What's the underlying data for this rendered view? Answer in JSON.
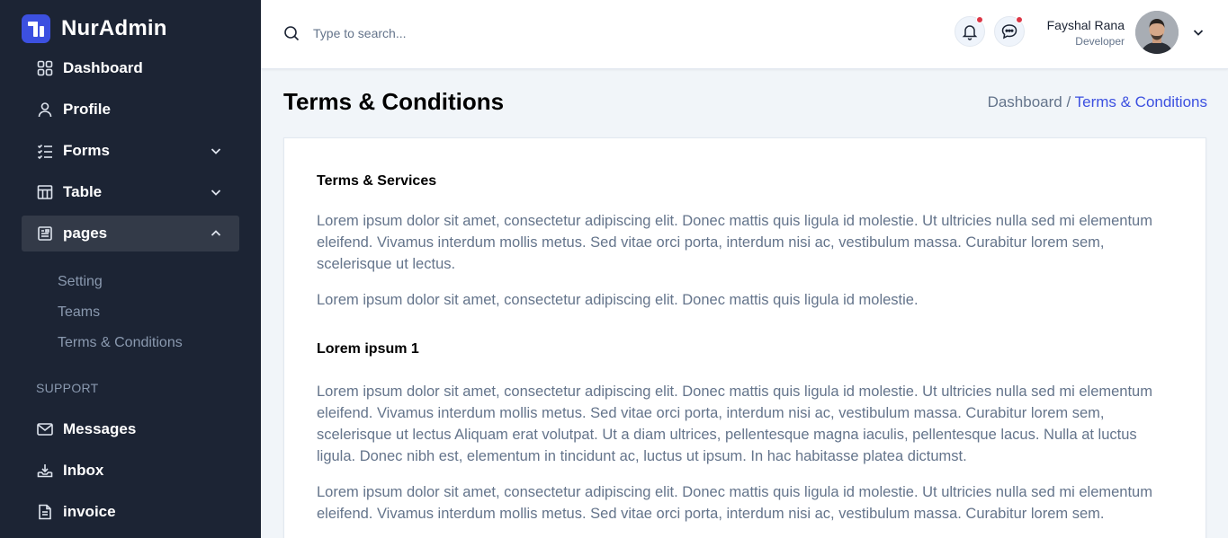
{
  "app": {
    "name": "NurAdmin"
  },
  "sidebar": {
    "items": [
      {
        "label": "Dashboard"
      },
      {
        "label": "Profile"
      },
      {
        "label": "Forms"
      },
      {
        "label": "Table"
      },
      {
        "label": "pages"
      }
    ],
    "pages_subitems": [
      {
        "label": "Setting"
      },
      {
        "label": "Teams"
      },
      {
        "label": "Terms & Conditions"
      }
    ],
    "support_label": "SUPPORT",
    "support_items": [
      {
        "label": "Messages"
      },
      {
        "label": "Inbox"
      },
      {
        "label": "invoice"
      }
    ]
  },
  "header": {
    "search_placeholder": "Type to search...",
    "user": {
      "name": "Fayshal Rana",
      "role": "Developer"
    }
  },
  "page": {
    "title": "Terms & Conditions",
    "breadcrumb": {
      "home": "Dashboard /",
      "current": "Terms & Conditions"
    }
  },
  "content": {
    "sections": [
      {
        "title": "Terms & Services",
        "paragraphs": [
          "Lorem ipsum dolor sit amet, consectetur adipiscing elit. Donec mattis quis ligula id molestie. Ut ultricies nulla sed mi elementum eleifend. Vivamus interdum mollis metus. Sed vitae orci porta, interdum nisi ac, vestibulum massa. Curabitur lorem sem, scelerisque ut lectus.",
          "Lorem ipsum dolor sit amet, consectetur adipiscing elit. Donec mattis quis ligula id molestie."
        ]
      },
      {
        "title": "Lorem ipsum 1",
        "paragraphs": [
          "Lorem ipsum dolor sit amet, consectetur adipiscing elit. Donec mattis quis ligula id molestie. Ut ultricies nulla sed mi elementum eleifend. Vivamus interdum mollis metus. Sed vitae orci porta, interdum nisi ac, vestibulum massa. Curabitur lorem sem, scelerisque ut lectus Aliquam erat volutpat. Ut a diam ultrices, pellentesque magna iaculis, pellentesque lacus. Nulla at luctus ligula. Donec nibh est, elementum in tincidunt ac, luctus ut ipsum. In hac habitasse platea dictumst.",
          "Lorem ipsum dolor sit amet, consectetur adipiscing elit. Donec mattis quis ligula id molestie. Ut ultricies nulla sed mi elementum eleifend. Vivamus interdum mollis metus. Sed vitae orci porta, interdum nisi ac, vestibulum massa. Curabitur lorem sem."
        ]
      }
    ]
  },
  "colors": {
    "sidebar_bg": "#1c2434",
    "accent": "#3c50e0",
    "notification_dot": "#dc3545",
    "page_bg": "#f1f5f9"
  }
}
